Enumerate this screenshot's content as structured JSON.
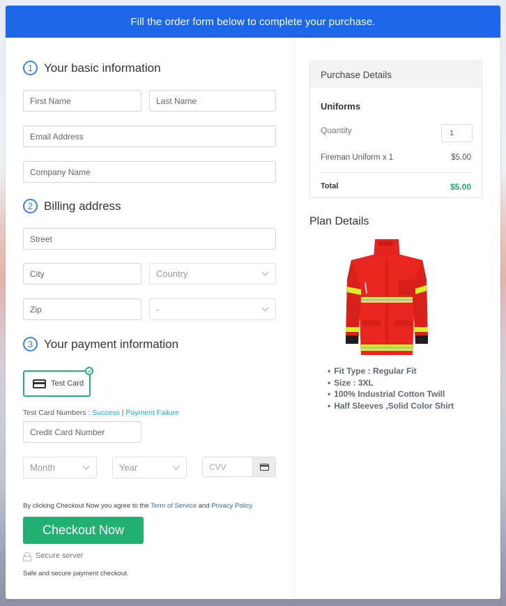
{
  "banner": {
    "text": "Fill the order form below to complete your purchase."
  },
  "sections": {
    "basic": {
      "number": "1",
      "title": "Your basic information"
    },
    "billing": {
      "number": "2",
      "title": "Billing address"
    },
    "payment": {
      "number": "3",
      "title": "Your payment information"
    }
  },
  "fields": {
    "first_name": "First Name",
    "last_name": "Last Name",
    "email": "Email Address",
    "company": "Company Name",
    "street": "Street",
    "city": "City",
    "country": "Country",
    "zip": "Zip",
    "state": "-",
    "card_number": "Credit Card Number",
    "month": "Month",
    "year": "Year",
    "cvv": "CVV"
  },
  "payment": {
    "method_label": "Test Card",
    "method_selected": true,
    "test_numbers_label": "Test Card Numbers : ",
    "success_link": "Success",
    "separator": " | ",
    "failure_link": "Payment Failure"
  },
  "agreement": {
    "prefix": "By clicking Checkout Now you agree to the ",
    "tos_link": "Term of Service",
    "middle": " and ",
    "privacy_link": "Privacy Policy"
  },
  "checkout_button": "Checkout Now",
  "secure_label": "Secure server",
  "safe_text": "Safe and secure payment checkout.",
  "purchase": {
    "header": "Purchase Details",
    "product": "Uniforms",
    "quantity_label": "Quantity",
    "quantity_value": "1",
    "line_item": "Fireman Uniform x 1",
    "line_price": "$5.00",
    "total_label": "Total",
    "total_value": "$5.00"
  },
  "plan": {
    "title": "Plan Details",
    "image_alt": "Red firefighter jacket with yellow reflective stripes",
    "features": [
      "Fit Type : Regular Fit",
      "Size : 3XL",
      "100% Industrial Cotton Twill",
      "Half Sleeves ,Solid Color Shirt"
    ]
  },
  "colors": {
    "banner": "#1b67e8",
    "accent_blue": "#3b82e6",
    "checkout_green": "#22b173",
    "total_green": "#26a96c",
    "link_teal": "#20a9c9",
    "link_blue": "#1f6fd1"
  }
}
